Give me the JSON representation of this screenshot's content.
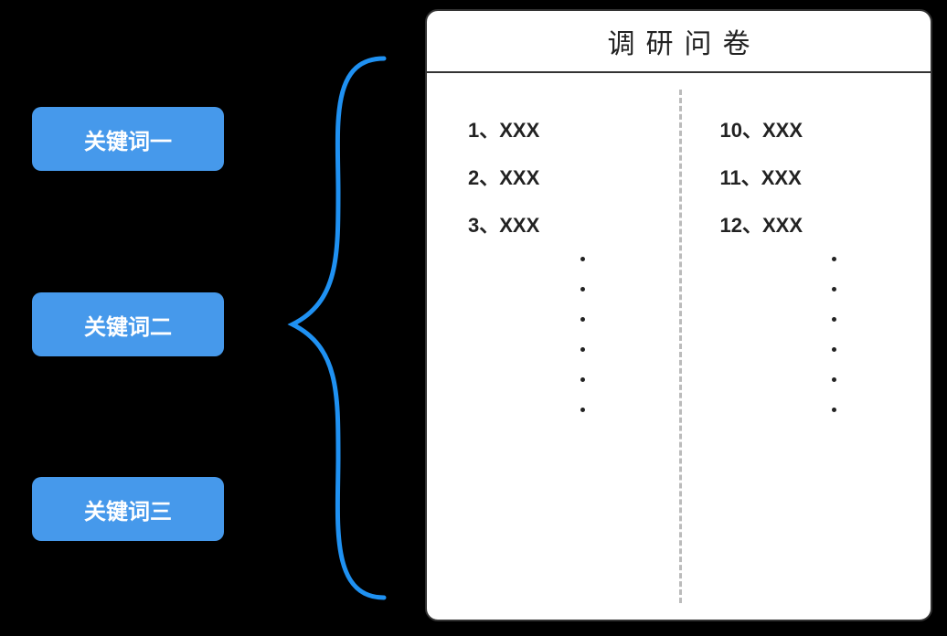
{
  "keywords": {
    "item1": "关键词一",
    "item2": "关键词二",
    "item3": "关键词三"
  },
  "panel": {
    "title": "调研问卷",
    "left_column": {
      "q1": "1、XXX",
      "q2": "2、XXX",
      "q3": "3、XXX"
    },
    "right_column": {
      "q10": "10、XXX",
      "q11": "11、XXX",
      "q12": "12、XXX"
    }
  },
  "colors": {
    "keyword_bg": "#4699eb",
    "brace": "#1f91f2",
    "panel_bg": "#ffffff",
    "text": "#222222"
  }
}
